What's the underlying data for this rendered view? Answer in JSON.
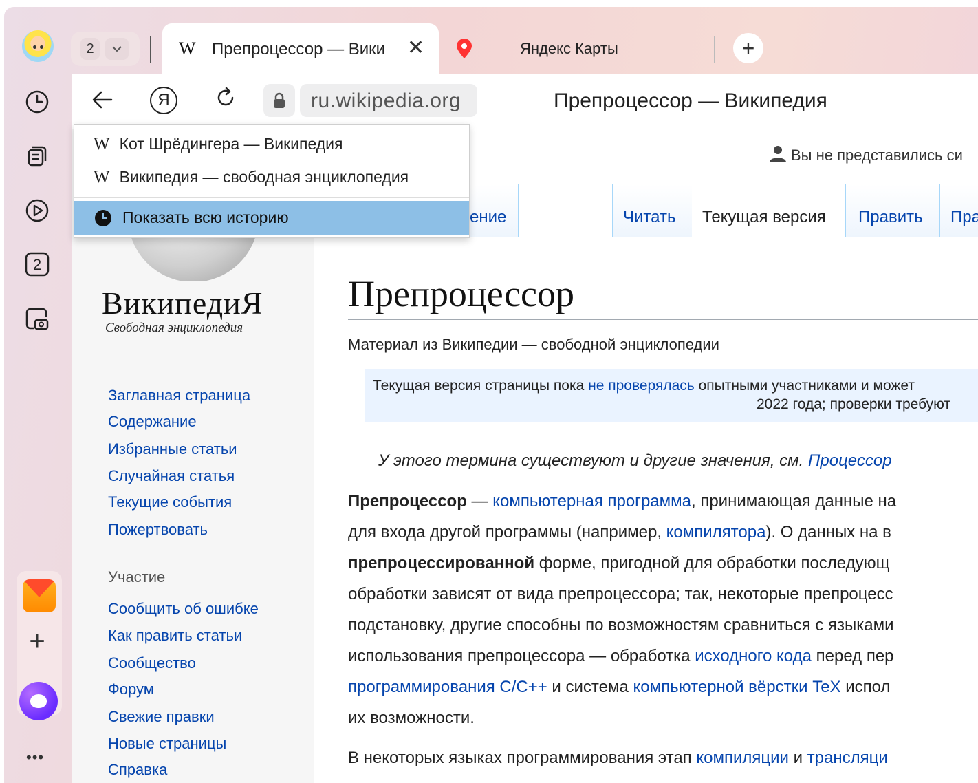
{
  "browser": {
    "tab_count": "2",
    "tabs": [
      {
        "icon": "wikipedia-w",
        "title": "Препроцессор — Вики",
        "active": true
      },
      {
        "icon": "map-pin",
        "title": "Яндекс Карты",
        "active": false
      }
    ],
    "close_glyph": "✕",
    "new_tab_glyph": "+",
    "address": {
      "url": "ru.wikipedia.org",
      "page_title": "Препроцессор — Википедия",
      "ya_glyph": "Я"
    },
    "sidebar": {
      "tab_badge": "2",
      "more_glyph": "•••",
      "add_glyph": "+"
    }
  },
  "history_dropdown": {
    "items": [
      {
        "icon": "W",
        "label": "Кот Шрёдингера — Википедия"
      },
      {
        "icon": "W",
        "label": "Википедия — свободная энциклопедия"
      }
    ],
    "show_all": "Показать всю историю"
  },
  "wiki": {
    "logo": "ВикипедиЯ",
    "tagline": "Свободная энциклопедия",
    "user_status": "Вы не представились си",
    "nav": [
      "Заглавная страница",
      "Содержание",
      "Избранные статьи",
      "Случайная статья",
      "Текущие события",
      "Пожертвовать"
    ],
    "participation_heading": "Участие",
    "participation": [
      "Сообщить об ошибке",
      "Как править статьи",
      "Сообщество",
      "Форум",
      "Свежие правки",
      "Новые страницы",
      "Справка"
    ],
    "page_tabs": {
      "discussion_partial": "ение",
      "read": "Читать",
      "current": "Текущая версия",
      "edit": "Править",
      "edit_code_partial": "Пра"
    },
    "article": {
      "title": "Препроцессор",
      "subtitle": "Материал из Википедии — свободной энциклопедии",
      "notice_l1_a": "Текущая версия страницы пока ",
      "notice_l1_link": "не проверялась",
      "notice_l1_b": " опытными участниками и может",
      "notice_l2": "2022 года; проверки требуют",
      "hatnote_a": "У этого термина существуют и другие значения, см. ",
      "hatnote_link": "Процессор",
      "p1_bold": "Препроцессор",
      "p1_a": " — ",
      "p1_link": "компьютерная программа",
      "p1_b": ", принимающая данные на",
      "p2_a": "для входа другой программы (например, ",
      "p2_link": "компилятора",
      "p2_b": "). О данных на в",
      "p3_bold": "препроцессированной",
      "p3_b": " форме, пригодной для обработки последующ",
      "p4": "обработки зависят от вида препроцессора; так, некоторые препроцесс",
      "p5": "подстановку, другие способны по возможностям сравниться с языками",
      "p6_a": "использования препроцессора — обработка ",
      "p6_link": "исходного кода",
      "p6_b": " перед пер",
      "p7_link1": "программирования C/C++",
      "p7_a": " и система ",
      "p7_link2": "компьютерной вёрстки TeX",
      "p7_b": " испол",
      "p8": "их возможности.",
      "p9_a": "В некоторых языках программирования этап ",
      "p9_link1": "компиляции",
      "p9_b": " и ",
      "p9_link2": "трансляци"
    }
  },
  "colors": {
    "link": "#0645ad",
    "highlight": "#8dbfe6",
    "frame": "#f3d6d6"
  }
}
